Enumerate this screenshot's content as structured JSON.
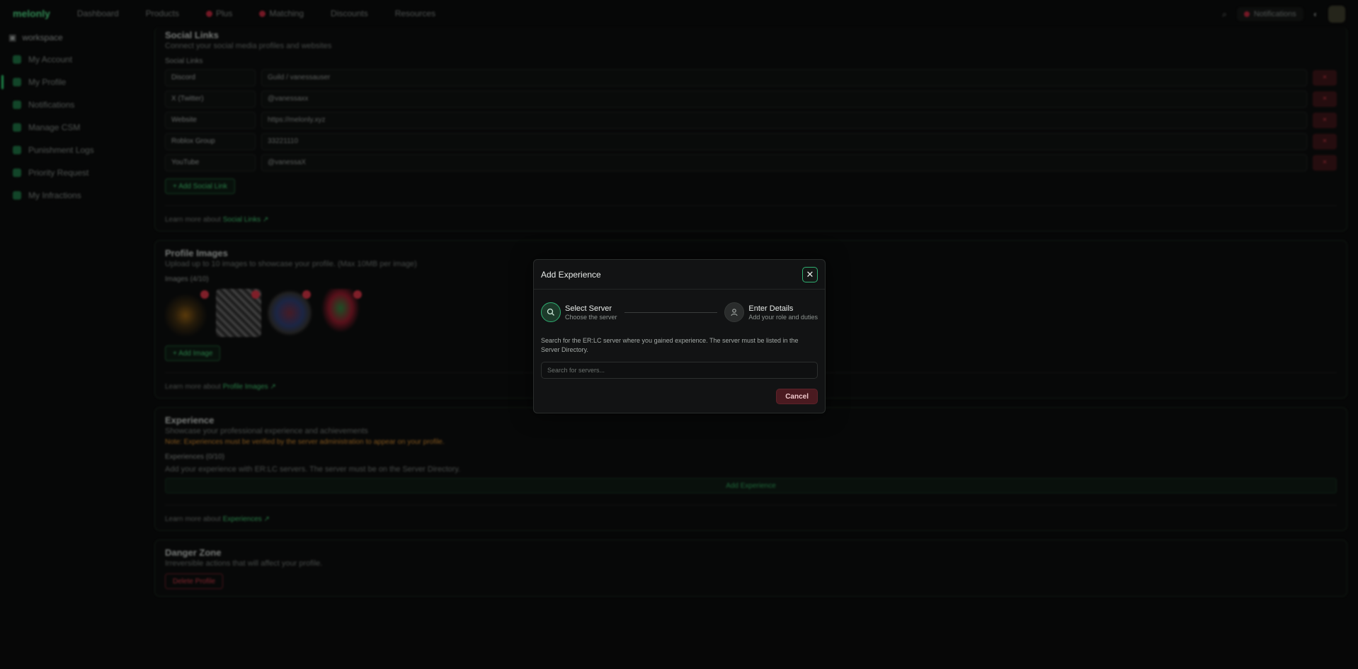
{
  "topbar": {
    "logo": "melonly",
    "nav": [
      "Dashboard",
      "Products",
      "Plus",
      "Matching",
      "Discounts",
      "Resources"
    ],
    "notifications_label": "Notifications"
  },
  "sidebar": {
    "workspace": "workspace",
    "items": [
      {
        "label": "My Account"
      },
      {
        "label": "My Profile"
      },
      {
        "label": "Notifications"
      },
      {
        "label": "Manage CSM"
      },
      {
        "label": "Punishment Logs"
      },
      {
        "label": "Priority Request"
      },
      {
        "label": "My Infractions"
      }
    ]
  },
  "social": {
    "title": "Social Links",
    "subtitle": "Connect your social media profiles and websites",
    "label": "Social Links",
    "rows": [
      {
        "platform": "Discord",
        "value": "Guild / vanessauser"
      },
      {
        "platform": "X (Twitter)",
        "value": "@vanessaxx"
      },
      {
        "platform": "Website",
        "value": "https://melonly.xyz"
      },
      {
        "platform": "Roblox Group",
        "value": "33221110"
      },
      {
        "platform": "YouTube",
        "value": "@vanessaX"
      }
    ],
    "delete_icon": "×",
    "add_label": "+ Add Social Link",
    "learn": "Learn more about",
    "learn_link": "Social Links ↗"
  },
  "images": {
    "title": "Profile Images",
    "subtitle": "Upload up to 10 images to showcase your profile. (Max 10MB per image)",
    "label": "Images (4/10)",
    "add_label": "+ Add Image",
    "learn": "Learn more about",
    "learn_link": "Profile Images ↗"
  },
  "experience": {
    "title": "Experience",
    "subtitle": "Showcase your professional experience and achievements",
    "warning": "Note: Experiences must be verified by the server administration to appear on your profile.",
    "label": "Experiences (0/10)",
    "hint": "Add your experience with ER:LC servers. The server must be on the Server Directory.",
    "add_label": "Add Experience",
    "learn": "Learn more about",
    "learn_link": "Experiences ↗"
  },
  "danger": {
    "title": "Danger Zone",
    "subtitle": "Irreversible actions that will affect your profile.",
    "button": "Delete Profile"
  },
  "modal": {
    "title": "Add Experience",
    "close_icon": "✕",
    "steps": [
      {
        "title": "Select Server",
        "sub": "Choose the server",
        "icon": "search-icon"
      },
      {
        "title": "Enter Details",
        "sub": "Add your role and duties",
        "icon": "user-icon"
      }
    ],
    "description": "Search for the ER:LC server where you gained experience. The server must be listed in the Server Directory.",
    "search_placeholder": "Search for servers...",
    "cancel_label": "Cancel"
  },
  "colors": {
    "accent": "#2fae71",
    "danger": "#4a1a20",
    "background": "#0a0b0b"
  }
}
